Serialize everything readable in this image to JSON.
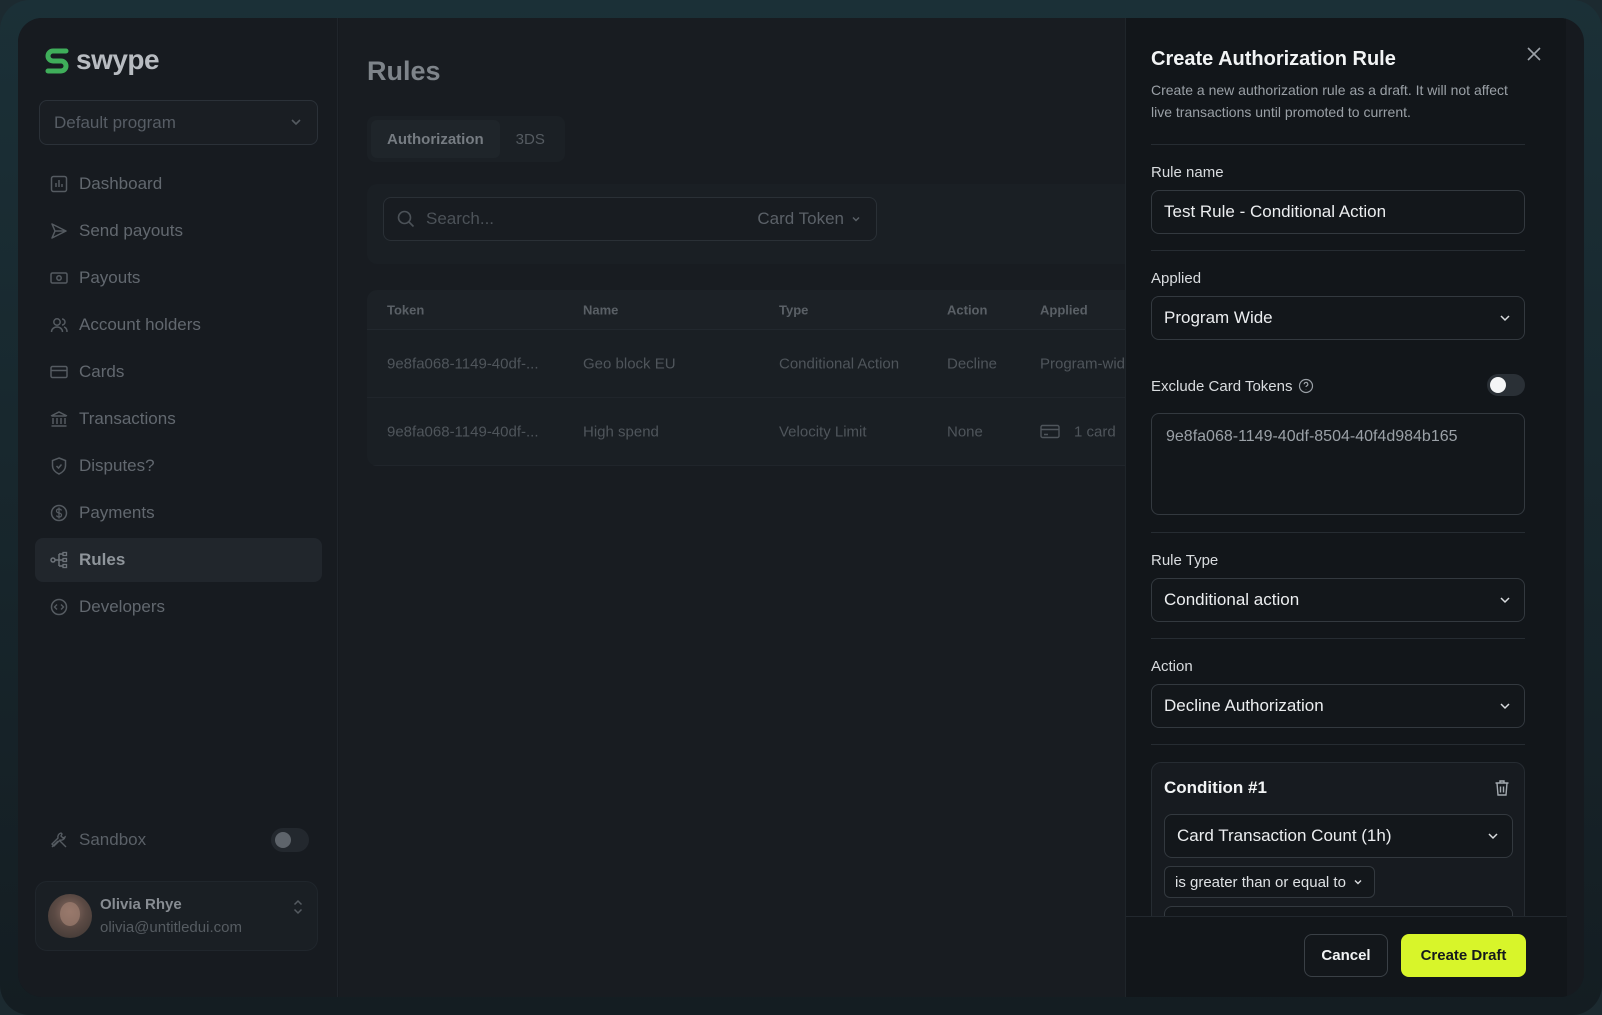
{
  "brand": {
    "name": "swype",
    "accent": "#d8f52a",
    "logo_color": "#3fae5a"
  },
  "sidebar": {
    "program_select": {
      "value": "Default program"
    },
    "items": [
      {
        "label": "Dashboard",
        "icon": "chart-icon"
      },
      {
        "label": "Send payouts",
        "icon": "send-icon"
      },
      {
        "label": "Payouts",
        "icon": "cash-icon"
      },
      {
        "label": "Account holders",
        "icon": "users-icon"
      },
      {
        "label": "Cards",
        "icon": "credit-card-icon"
      },
      {
        "label": "Transactions",
        "icon": "bank-icon"
      },
      {
        "label": "Disputes?",
        "icon": "shield-icon"
      },
      {
        "label": "Payments",
        "icon": "dollar-icon"
      },
      {
        "label": "Rules",
        "icon": "rules-icon",
        "active": true
      },
      {
        "label": "Developers",
        "icon": "code-icon"
      }
    ],
    "sandbox": {
      "label": "Sandbox",
      "enabled": false
    },
    "user": {
      "name": "Olivia Rhye",
      "email": "olivia@untitledui.com"
    }
  },
  "main": {
    "title": "Rules",
    "tabs": [
      {
        "label": "Authorization",
        "active": true
      },
      {
        "label": "3DS",
        "active": false
      }
    ],
    "search": {
      "placeholder": "Search...",
      "filter": "Card Token"
    },
    "table": {
      "columns": [
        "Token",
        "Name",
        "Type",
        "Action",
        "Applied"
      ],
      "rows": [
        {
          "token": "9e8fa068-1149-40df-...",
          "name": "Geo block EU",
          "type": "Conditional Action",
          "action": "Decline",
          "applied": "Program-wide"
        },
        {
          "token": "9e8fa068-1149-40df-...",
          "name": "High spend",
          "type": "Velocity Limit",
          "action": "None",
          "applied": "1 card"
        }
      ]
    }
  },
  "drawer": {
    "title": "Create Authorization Rule",
    "description": "Create a new authorization rule as a draft. It will not affect live transactions until promoted to current.",
    "rule_name": {
      "label": "Rule name",
      "value": "Test Rule - Conditional Action"
    },
    "applied": {
      "label": "Applied",
      "value": "Program Wide"
    },
    "exclude": {
      "label": "Exclude Card Tokens",
      "enabled": false,
      "tokens": "9e8fa068-1149-40df-8504-40f4d984b165"
    },
    "rule_type": {
      "label": "Rule Type",
      "value": "Conditional action"
    },
    "action": {
      "label": "Action",
      "value": "Decline Authorization"
    },
    "condition": {
      "title": "Condition #1",
      "attribute": "Card Transaction Count (1h)",
      "operator": "is greater than or equal to"
    },
    "buttons": {
      "cancel": "Cancel",
      "create": "Create Draft"
    }
  }
}
